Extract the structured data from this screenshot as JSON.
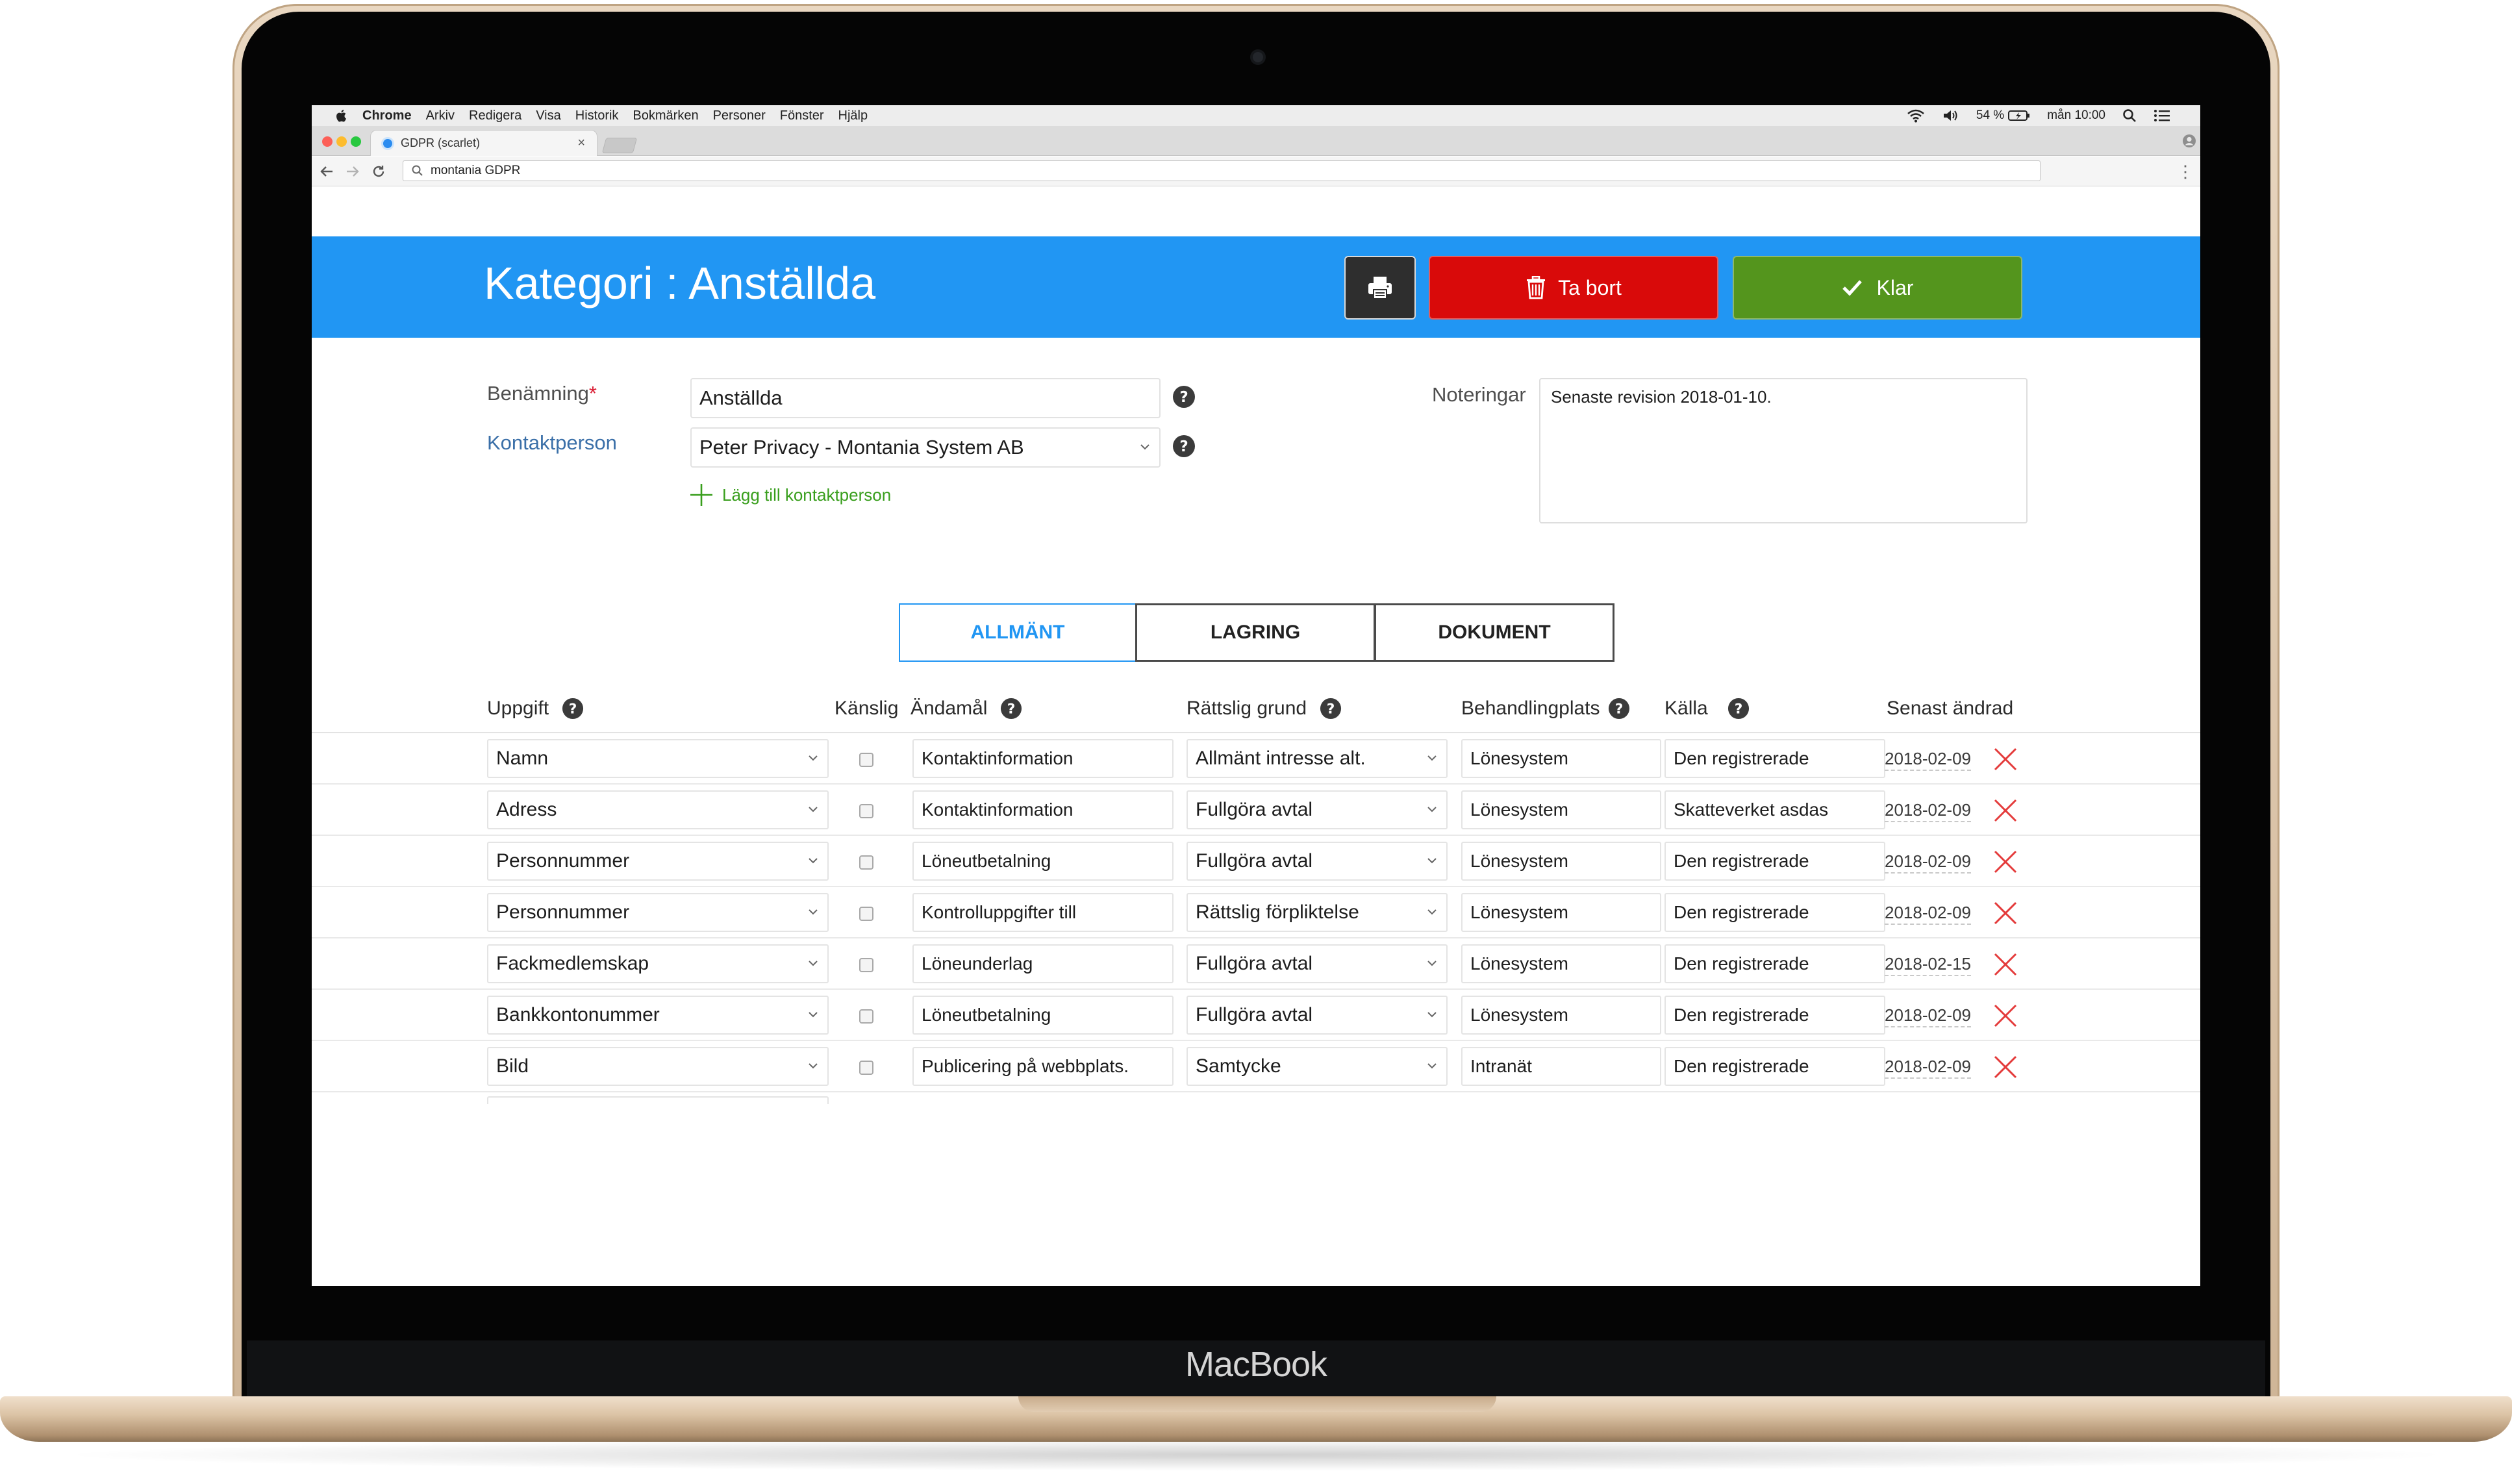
{
  "device": {
    "brand": "MacBook"
  },
  "menubar": {
    "items": [
      "Chrome",
      "Arkiv",
      "Redigera",
      "Visa",
      "Historik",
      "Bokmärken",
      "Personer",
      "Fönster",
      "Hjälp"
    ],
    "battery": "54 %",
    "clock": "mån 10:00"
  },
  "browser": {
    "tab_title": "GDPR (scarlet)",
    "address": "montania GDPR"
  },
  "header": {
    "title": "Kategori : Anställda",
    "delete_label": "Ta bort",
    "done_label": "Klar",
    "colors": {
      "header_bg": "#2196f3",
      "delete_bg": "#d90a0a",
      "done_bg": "#54951d",
      "print_bg": "#2e2e2e"
    }
  },
  "form": {
    "name_label": "Benämning",
    "required_mark": "*",
    "name_value": "Anställda",
    "contact_label": "Kontaktperson",
    "contact_value": "Peter Privacy - Montania System AB",
    "add_contact": "Lägg till kontaktperson",
    "notes_label": "Noteringar",
    "notes_value": "Senaste revision 2018-01-10."
  },
  "tabs": [
    {
      "label": "ALLMÄNT",
      "active": true
    },
    {
      "label": "LAGRING",
      "active": false
    },
    {
      "label": "DOKUMENT",
      "active": false
    }
  ],
  "table": {
    "headers": {
      "task": "Uppgift",
      "sensitive": "Känslig",
      "purpose": "Ändamål",
      "legal": "Rättslig grund",
      "place": "Behandlingplats",
      "source": "Källa",
      "changed": "Senast ändrad"
    },
    "rows": [
      {
        "task": "Namn",
        "sensitive": false,
        "purpose": "Kontaktinformation",
        "legal": "Allmänt intresse alt.",
        "place": "Lönesystem",
        "source": "Den registrerade",
        "changed": "2018-02-09"
      },
      {
        "task": "Adress",
        "sensitive": false,
        "purpose": "Kontaktinformation",
        "legal": "Fullgöra avtal",
        "place": "Lönesystem",
        "source": "Skatteverket asdas",
        "changed": "2018-02-09"
      },
      {
        "task": "Personnummer",
        "sensitive": false,
        "purpose": "Löneutbetalning",
        "legal": "Fullgöra avtal",
        "place": "Lönesystem",
        "source": "Den registrerade",
        "changed": "2018-02-09"
      },
      {
        "task": "Personnummer",
        "sensitive": false,
        "purpose": "Kontrolluppgifter till",
        "legal": "Rättslig förpliktelse",
        "place": "Lönesystem",
        "source": "Den registrerade",
        "changed": "2018-02-09"
      },
      {
        "task": "Fackmedlemskap",
        "sensitive": false,
        "purpose": "Löneunderlag",
        "legal": "Fullgöra avtal",
        "place": "Lönesystem",
        "source": "Den registrerade",
        "changed": "2018-02-15"
      },
      {
        "task": "Bankkontonummer",
        "sensitive": false,
        "purpose": "Löneutbetalning",
        "legal": "Fullgöra avtal",
        "place": "Lönesystem",
        "source": "Den registrerade",
        "changed": "2018-02-09"
      },
      {
        "task": "Bild",
        "sensitive": false,
        "purpose": "Publicering på webbplats.",
        "legal": "Samtycke",
        "place": "Intranät",
        "source": "Den registrerade",
        "changed": "2018-02-09"
      }
    ]
  }
}
